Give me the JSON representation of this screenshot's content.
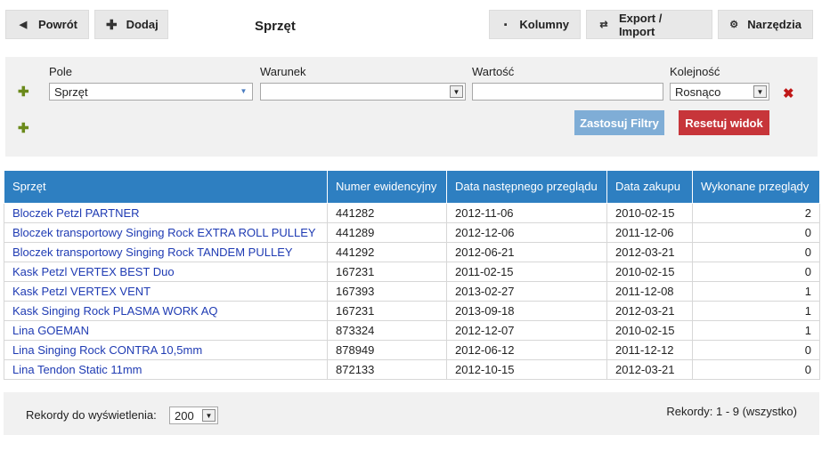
{
  "toolbar": {
    "back_label": "Powrót",
    "add_label": "Dodaj",
    "title": "Sprzęt",
    "columns_label": "Kolumny",
    "export_label": "Export / Import",
    "tools_label": "Narzędzia"
  },
  "filters": {
    "field_label": "Pole",
    "condition_label": "Warunek",
    "value_label": "Wartość",
    "order_label": "Kolejność",
    "field_value": "Sprzęt",
    "condition_value": "",
    "value_value": "",
    "order_value": "Rosnąco",
    "apply_label": "Zastosuj Filtry",
    "reset_label": "Resetuj widok"
  },
  "table": {
    "headers": [
      "Sprzęt",
      "Numer ewidencyjny",
      "Data następnego przeglądu",
      "Data zakupu",
      "Wykonane przeglądy"
    ],
    "rows": [
      [
        "Bloczek Petzl PARTNER",
        "441282",
        "2012-11-06",
        "2010-02-15",
        "2"
      ],
      [
        "Bloczek transportowy Singing Rock EXTRA ROLL PULLEY",
        "441289",
        "2012-12-06",
        "2011-12-06",
        "0"
      ],
      [
        "Bloczek transportowy Singing Rock TANDEM PULLEY",
        "441292",
        "2012-06-21",
        "2012-03-21",
        "0"
      ],
      [
        "Kask Petzl VERTEX BEST Duo",
        "167231",
        "2011-02-15",
        "2010-02-15",
        "0"
      ],
      [
        "Kask Petzl VERTEX VENT",
        "167393",
        "2013-02-27",
        "2011-12-08",
        "1"
      ],
      [
        "Kask Singing Rock PLASMA WORK AQ",
        "167231",
        "2013-09-18",
        "2012-03-21",
        "1"
      ],
      [
        "Lina GOEMAN",
        "873324",
        "2012-12-07",
        "2010-02-15",
        "1"
      ],
      [
        "Lina Singing Rock CONTRA 10,5mm",
        "878949",
        "2012-06-12",
        "2011-12-12",
        "0"
      ],
      [
        "Lina Tendon Static 11mm",
        "872133",
        "2012-10-15",
        "2012-03-21",
        "0"
      ]
    ]
  },
  "footer": {
    "records_label": "Rekordy do wyświetlenia:",
    "records_value": "200",
    "records_info": "Rekordy: 1 - 9 (wszystko)"
  },
  "icons": {
    "back": "triangle-left-icon",
    "add": "plus-icon",
    "columns": "columns-icon",
    "export": "sync-arrows-icon",
    "tools": "gear-icon",
    "add_filter": "plus-icon",
    "remove_filter": "close-icon"
  },
  "colors": {
    "header_bg": "#2e7fc1",
    "link": "#1f3bb3",
    "apply_btn": "#7fadd6",
    "reset_btn": "#c7353a",
    "plus": "#6b8a1b",
    "close": "#c01818"
  }
}
